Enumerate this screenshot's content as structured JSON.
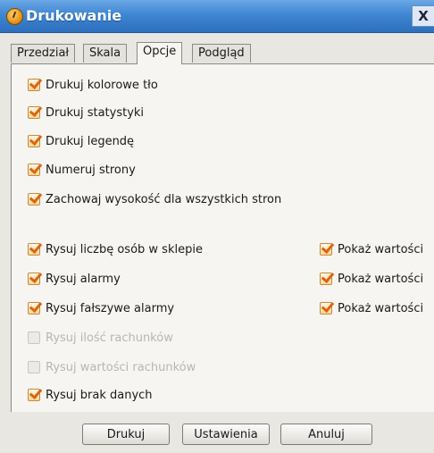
{
  "window": {
    "title": "Drukowanie",
    "close_label": "X"
  },
  "tabs": [
    {
      "label": "Przedział",
      "active": false
    },
    {
      "label": "Skala",
      "active": false
    },
    {
      "label": "Opcje",
      "active": true
    },
    {
      "label": "Podgląd",
      "active": false
    }
  ],
  "options": {
    "general": [
      {
        "label": "Drukuj kolorowe tło",
        "checked": true,
        "enabled": true
      },
      {
        "label": "Drukuj statystyki",
        "checked": true,
        "enabled": true
      },
      {
        "label": "Drukuj legendę",
        "checked": true,
        "enabled": true
      },
      {
        "label": "Numeruj strony",
        "checked": true,
        "enabled": true
      },
      {
        "label": "Zachowaj wysokość dla wszystkich stron",
        "checked": true,
        "enabled": true
      }
    ],
    "series": [
      {
        "label": "Rysuj liczbę osób w sklepie",
        "checked": true,
        "enabled": true
      },
      {
        "label": "Rysuj alarmy",
        "checked": true,
        "enabled": true
      },
      {
        "label": "Rysuj fałszywe alarmy",
        "checked": true,
        "enabled": true
      },
      {
        "label": "Rysuj ilość rachunków",
        "checked": false,
        "enabled": false
      },
      {
        "label": "Rysuj wartości rachunków",
        "checked": false,
        "enabled": false
      },
      {
        "label": "Rysuj brak danych",
        "checked": true,
        "enabled": true
      }
    ],
    "show_values": [
      {
        "label": "Pokaż wartości",
        "checked": true,
        "enabled": true
      },
      {
        "label": "Pokaż wartości",
        "checked": true,
        "enabled": true
      },
      {
        "label": "Pokaż wartości",
        "checked": true,
        "enabled": true
      }
    ]
  },
  "buttons": {
    "print": "Drukuj",
    "settings": "Ustawienia",
    "cancel": "Anuluj"
  },
  "colors": {
    "titlebar": "#3f86d2",
    "check": "#d9660f",
    "panel": "#f6f5f2"
  }
}
